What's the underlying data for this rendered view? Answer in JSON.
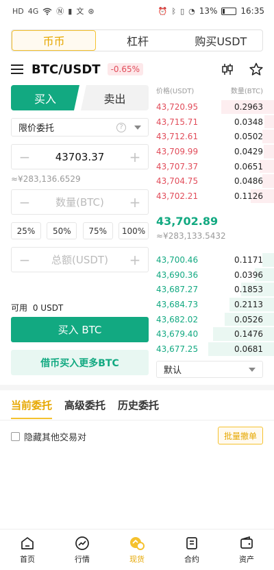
{
  "status_bar": {
    "left_icons": [
      "HD",
      "4G",
      "wifi",
      "N",
      "notification",
      "translate",
      "app"
    ],
    "battery": "13%",
    "time": "16:35"
  },
  "segments": [
    {
      "label": "币币",
      "active": true
    },
    {
      "label": "杠杆",
      "active": false
    },
    {
      "label": "购买USDT",
      "active": false
    }
  ],
  "pair": {
    "name": "BTC/USDT",
    "change": "-0.65%",
    "icons": [
      "menu-icon",
      "candlestick-icon",
      "star-icon"
    ]
  },
  "trade": {
    "buy_tab": "买入",
    "sell_tab": "卖出",
    "order_type": "限价委托",
    "price_value": "43703.37",
    "price_approx": "≈¥283,136.6529",
    "quantity_placeholder": "数量(BTC)",
    "percents": [
      "25%",
      "50%",
      "75%",
      "100%"
    ],
    "total_placeholder": "总额(USDT)",
    "available_label": "可用",
    "available_value": "0 USDT",
    "buy_button": "买入 BTC",
    "borrow_button": "借币买入更多BTC"
  },
  "order_book": {
    "price_header": "价格(USDT)",
    "qty_header": "数量(BTC)",
    "asks": [
      {
        "price": "43,720.95",
        "qty": "0.2963",
        "depth": 0.45
      },
      {
        "price": "43,715.71",
        "qty": "0.0348",
        "depth": 0.08
      },
      {
        "price": "43,712.61",
        "qty": "0.0502",
        "depth": 0.1
      },
      {
        "price": "43,709.99",
        "qty": "0.0429",
        "depth": 0.09
      },
      {
        "price": "43,707.37",
        "qty": "0.0651",
        "depth": 0.12
      },
      {
        "price": "43,704.75",
        "qty": "0.0486",
        "depth": 0.1
      },
      {
        "price": "43,702.21",
        "qty": "0.1126",
        "depth": 0.2
      }
    ],
    "mid_price": "43,702.89",
    "mid_approx": "≈¥283,133.5432",
    "bids": [
      {
        "price": "43,700.46",
        "qty": "0.1171",
        "depth": 0.1
      },
      {
        "price": "43,690.36",
        "qty": "0.0396",
        "depth": 0.16
      },
      {
        "price": "43,687.27",
        "qty": "0.1853",
        "depth": 0.28
      },
      {
        "price": "43,684.73",
        "qty": "0.2113",
        "depth": 0.38
      },
      {
        "price": "43,682.02",
        "qty": "0.0526",
        "depth": 0.42
      },
      {
        "price": "43,679.40",
        "qty": "0.1476",
        "depth": 0.52
      },
      {
        "price": "43,677.25",
        "qty": "0.0681",
        "depth": 0.56
      }
    ],
    "depth_option": "默认"
  },
  "orders": {
    "tabs": [
      "当前委托",
      "高级委托",
      "历史委托"
    ],
    "hide_other_pairs": "隐藏其他交易对",
    "batch_cancel": "批量撤单"
  },
  "bottom_nav": [
    {
      "label": "首页",
      "icon": "home-icon",
      "active": false
    },
    {
      "label": "行情",
      "icon": "market-icon",
      "active": false
    },
    {
      "label": "现货",
      "icon": "spot-icon",
      "active": true
    },
    {
      "label": "合约",
      "icon": "contract-icon",
      "active": false
    },
    {
      "label": "资产",
      "icon": "wallet-icon",
      "active": false
    }
  ],
  "colors": {
    "accent": "#f5c12d",
    "buy": "#12a981",
    "sell": "#e14c5a"
  }
}
